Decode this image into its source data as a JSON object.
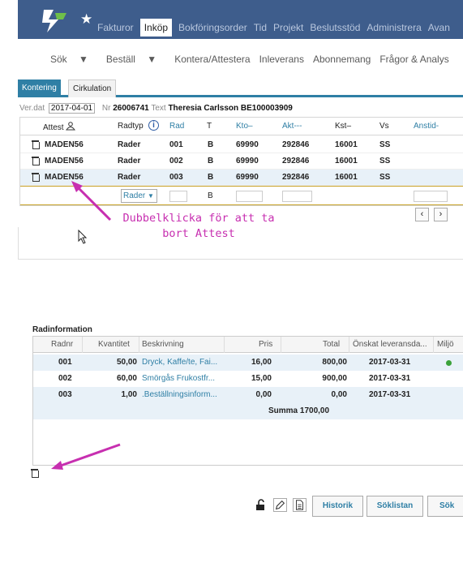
{
  "topnav": {
    "main_items": [
      "Fakturor",
      "Inköp",
      "Bokföringsorder",
      "Tid",
      "Projekt",
      "Beslutsstöd",
      "Administrera",
      "Avan"
    ],
    "active": "Inköp",
    "sub_items": [
      "Sök",
      "Beställ",
      "Kontera/Attestera",
      "Inleverans",
      "Abonnemang",
      "Frågor & Analys"
    ]
  },
  "tabs": {
    "kontering": "Kontering",
    "cirkulation": "Cirkulation"
  },
  "header": {
    "verdat_label": "Ver.dat",
    "verdat_value": "2017-04-01",
    "nr_label": "Nr",
    "nr_value": "26006741",
    "text_label": "Text",
    "text_value": "Theresia Carlsson BE100003909"
  },
  "attest_grid": {
    "columns": [
      "Attest",
      "Radtyp",
      "Rad",
      "T",
      "Kto–",
      "Akt---",
      "Kst–",
      "Vs",
      "Anstid-"
    ],
    "rows": [
      {
        "attest": "MADEN56",
        "radtyp": "Rader",
        "rad": "001",
        "t": "B",
        "kto": "69990",
        "akt": "292846",
        "kst": "16001",
        "vs": "SS"
      },
      {
        "attest": "MADEN56",
        "radtyp": "Rader",
        "rad": "002",
        "t": "B",
        "kto": "69990",
        "akt": "292846",
        "kst": "16001",
        "vs": "SS"
      },
      {
        "attest": "MADEN56",
        "radtyp": "Rader",
        "rad": "003",
        "t": "B",
        "kto": "69990",
        "akt": "292846",
        "kst": "16001",
        "vs": "SS"
      }
    ],
    "input_row": {
      "radtyp": "Rader",
      "t": "B"
    }
  },
  "annotation_text": "Dubbelklicka för att ta bort Attest",
  "radinfo": {
    "title": "Radinformation",
    "columns": [
      "Radnr",
      "Kvantitet",
      "Beskrivning",
      "Pris",
      "Total",
      "Önskat leveransda...",
      "Miljö"
    ],
    "rows": [
      {
        "radnr": "001",
        "kvantitet": "50,00",
        "beskrivning": "Dryck, Kaffe/te, Fai...",
        "pris": "16,00",
        "total": "800,00",
        "datum": "2017-03-31"
      },
      {
        "radnr": "002",
        "kvantitet": "60,00",
        "beskrivning": "Smörgås Frukostfr...",
        "pris": "15,00",
        "total": "900,00",
        "datum": "2017-03-31"
      },
      {
        "radnr": "003",
        "kvantitet": "1,00",
        "beskrivning": ".Beställningsinform...",
        "pris": "0,00",
        "total": "0,00",
        "datum": "2017-03-31"
      }
    ],
    "summa": "Summa 1700,00"
  },
  "toolbar": {
    "historik": "Historik",
    "soklistan": "Söklistan",
    "sok": "Sök"
  },
  "colors": {
    "nav": "#3e5d8c",
    "accent": "#2f7fa5",
    "annotation": "#c72fb0"
  }
}
